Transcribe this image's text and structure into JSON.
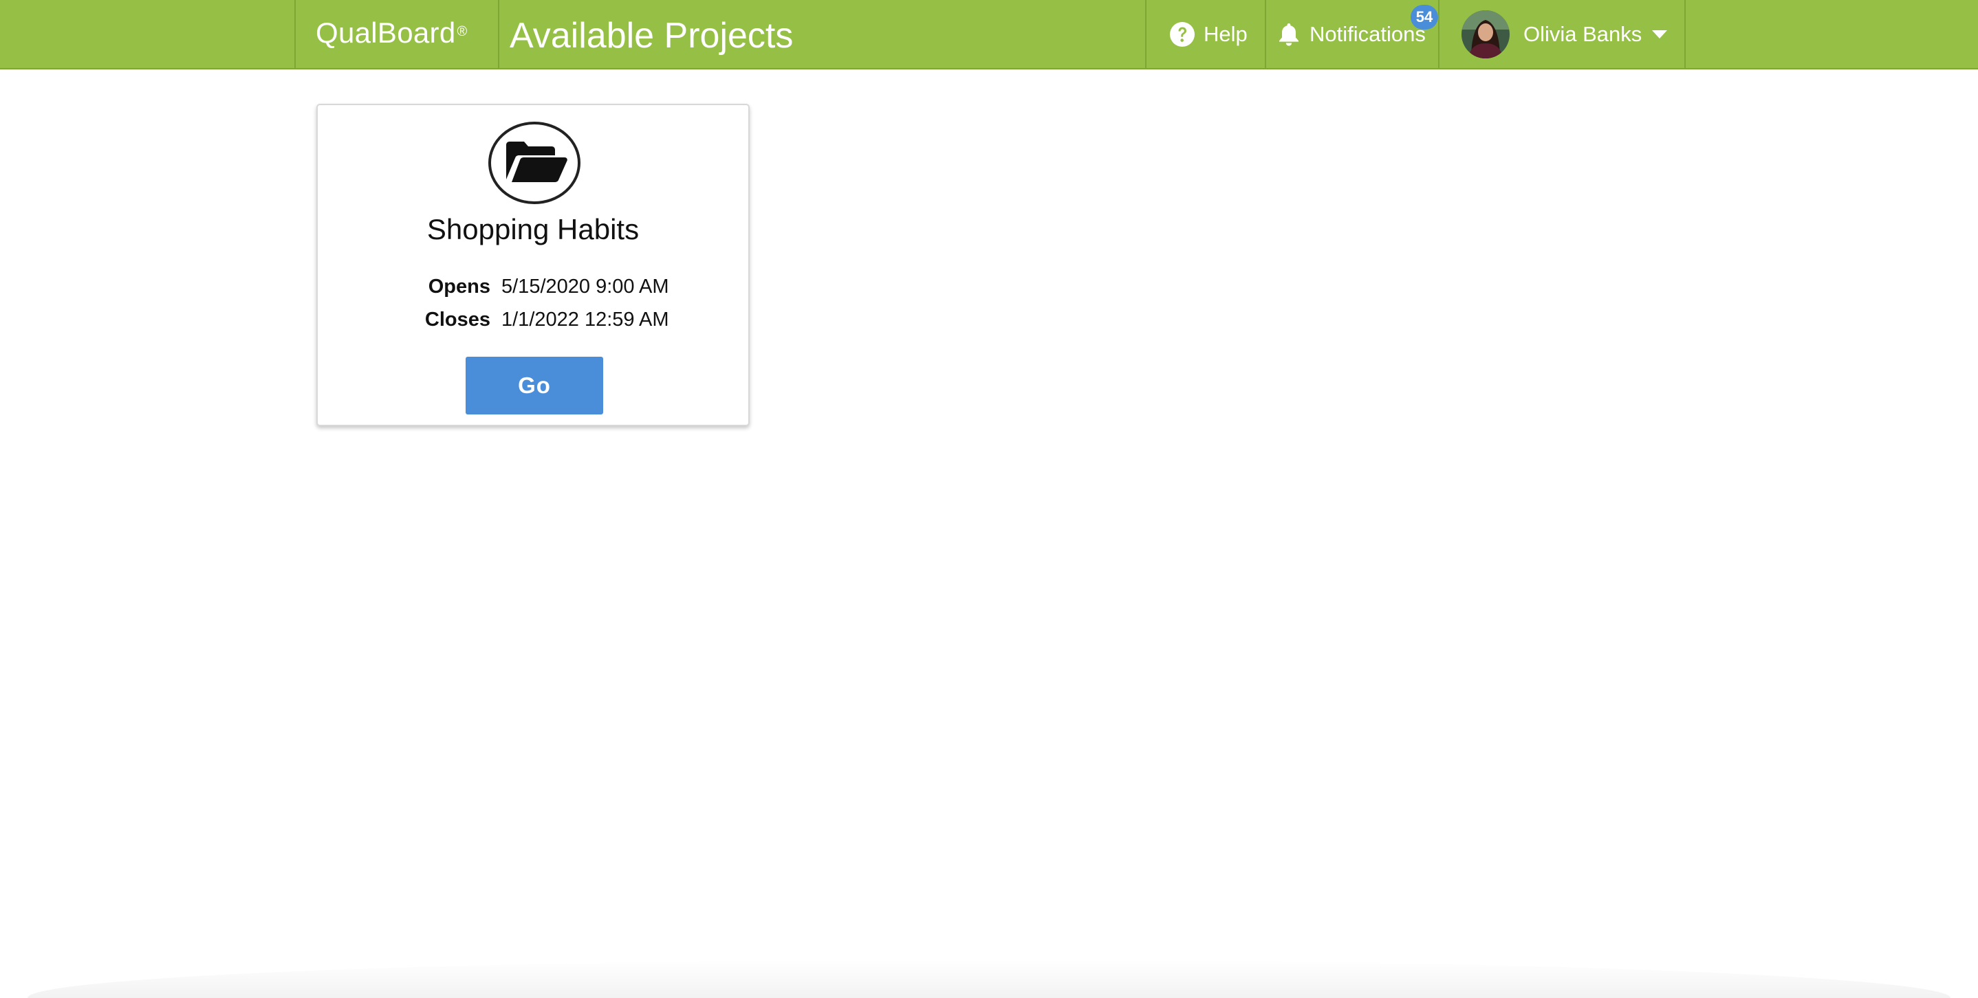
{
  "header": {
    "brand": "QualBoard",
    "brand_mark": "®",
    "page_title": "Available Projects",
    "accent_color": "#96c045",
    "nav": {
      "help_label": "Help",
      "help_icon": "question-circle-icon",
      "notifications_label": "Notifications",
      "notifications_icon": "bell-icon",
      "notifications_count": "54",
      "user_name": "Olivia Banks",
      "user_menu_icon": "caret-down-icon"
    }
  },
  "projects": [
    {
      "icon": "folder-open-icon",
      "name": "Shopping Habits",
      "opens_label": "Opens",
      "opens_value": "5/15/2020 9:00 AM",
      "closes_label": "Closes",
      "closes_value": "1/1/2022 12:59 AM",
      "action_label": "Go",
      "action_color": "#4a8ed9"
    }
  ]
}
